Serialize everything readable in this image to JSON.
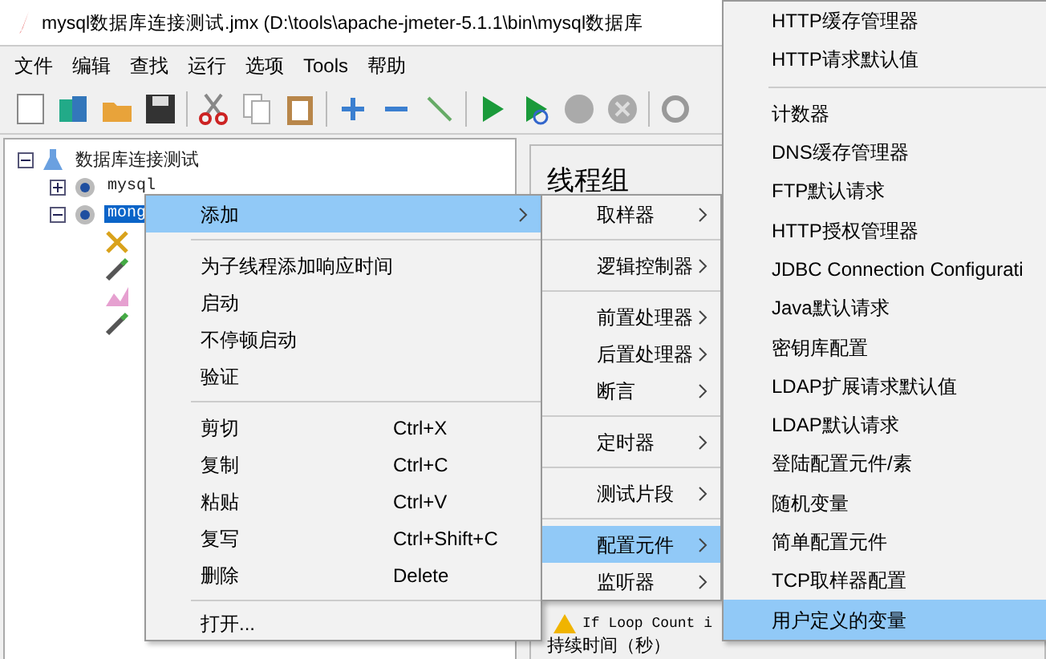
{
  "window": {
    "title": "mysql数据库连接测试.jmx (D:\\tools\\apache-jmeter-5.1.1\\bin\\mysql数据库"
  },
  "menubar": [
    "文件",
    "编辑",
    "查找",
    "运行",
    "选项",
    "Tools",
    "帮助"
  ],
  "toolbar": [
    {
      "kind": "new"
    },
    {
      "kind": "templates"
    },
    {
      "kind": "open"
    },
    {
      "kind": "save"
    },
    {
      "kind": "sep"
    },
    {
      "kind": "cut"
    },
    {
      "kind": "copy"
    },
    {
      "kind": "paste"
    },
    {
      "kind": "sep"
    },
    {
      "kind": "add"
    },
    {
      "kind": "remove"
    },
    {
      "kind": "toggle"
    },
    {
      "kind": "sep"
    },
    {
      "kind": "start"
    },
    {
      "kind": "start-no-pause"
    },
    {
      "kind": "stop"
    },
    {
      "kind": "shutdown"
    },
    {
      "kind": "sep"
    },
    {
      "kind": "gear"
    }
  ],
  "tree": [
    {
      "label": "数据库连接测试",
      "kind": "plan",
      "expanded": true,
      "selected": false,
      "children": [
        {
          "label": "mysql",
          "kind": "group",
          "expanded": false,
          "selected": false
        },
        {
          "label": "mong",
          "kind": "group",
          "expanded": true,
          "selected": true,
          "children": [
            {
              "kind": "tool"
            },
            {
              "kind": "sampler"
            },
            {
              "kind": "listener"
            },
            {
              "kind": "sampler"
            }
          ]
        }
      ]
    }
  ],
  "panel": {
    "title": "线程组",
    "warning": "If Loop Count i",
    "duration_label": "持续时间（秒）"
  },
  "context_menu": [
    {
      "kind": "item",
      "label": "添加",
      "submenu": true,
      "selected": true
    },
    {
      "kind": "separator"
    },
    {
      "kind": "item",
      "label": "为子线程添加响应时间",
      "selected": false
    },
    {
      "kind": "item",
      "label": "启动",
      "selected": false
    },
    {
      "kind": "item",
      "label": "不停顿启动",
      "selected": false
    },
    {
      "kind": "item",
      "label": "验证",
      "selected": false
    },
    {
      "kind": "separator"
    },
    {
      "kind": "item",
      "label": "剪切",
      "shortcut": "Ctrl+X",
      "selected": false
    },
    {
      "kind": "item",
      "label": "复制",
      "shortcut": "Ctrl+C",
      "selected": false
    },
    {
      "kind": "item",
      "label": "粘贴",
      "shortcut": "Ctrl+V",
      "selected": false
    },
    {
      "kind": "item",
      "label": "复写",
      "shortcut": "Ctrl+Shift+C",
      "selected": false
    },
    {
      "kind": "item",
      "label": "删除",
      "shortcut": "Delete",
      "selected": false
    },
    {
      "kind": "separator"
    },
    {
      "kind": "item",
      "label": "打开...",
      "selected": false
    }
  ],
  "add_submenu": [
    {
      "kind": "item",
      "label": "取样器",
      "submenu": true,
      "selected": false
    },
    {
      "kind": "separator"
    },
    {
      "kind": "item",
      "label": "逻辑控制器",
      "submenu": true,
      "selected": false
    },
    {
      "kind": "separator"
    },
    {
      "kind": "item",
      "label": "前置处理器",
      "submenu": true,
      "selected": false
    },
    {
      "kind": "item",
      "label": "后置处理器",
      "submenu": true,
      "selected": false
    },
    {
      "kind": "item",
      "label": "断言",
      "submenu": true,
      "selected": false
    },
    {
      "kind": "separator"
    },
    {
      "kind": "item",
      "label": "定时器",
      "submenu": true,
      "selected": false
    },
    {
      "kind": "separator"
    },
    {
      "kind": "item",
      "label": "测试片段",
      "submenu": true,
      "selected": false
    },
    {
      "kind": "separator"
    },
    {
      "kind": "item",
      "label": "配置元件",
      "submenu": true,
      "selected": true
    },
    {
      "kind": "item",
      "label": "监听器",
      "submenu": true,
      "selected": false
    }
  ],
  "config_submenu": [
    {
      "kind": "item",
      "label": "HTTP缓存管理器",
      "selected": false
    },
    {
      "kind": "item",
      "label": "HTTP请求默认值",
      "selected": false
    },
    {
      "kind": "separator"
    },
    {
      "kind": "item",
      "label": "计数器",
      "selected": false
    },
    {
      "kind": "item",
      "label": "DNS缓存管理器",
      "selected": false
    },
    {
      "kind": "item",
      "label": "FTP默认请求",
      "selected": false
    },
    {
      "kind": "item",
      "label": "HTTP授权管理器",
      "selected": false
    },
    {
      "kind": "item",
      "label": "JDBC Connection Configurati",
      "selected": false
    },
    {
      "kind": "item",
      "label": "Java默认请求",
      "selected": false
    },
    {
      "kind": "item",
      "label": "密钥库配置",
      "selected": false
    },
    {
      "kind": "item",
      "label": "LDAP扩展请求默认值",
      "selected": false
    },
    {
      "kind": "item",
      "label": "LDAP默认请求",
      "selected": false
    },
    {
      "kind": "item",
      "label": "登陆配置元件/素",
      "selected": false
    },
    {
      "kind": "item",
      "label": "随机变量",
      "selected": false
    },
    {
      "kind": "item",
      "label": "简单配置元件",
      "selected": false
    },
    {
      "kind": "item",
      "label": "TCP取样器配置",
      "selected": false
    },
    {
      "kind": "item",
      "label": "用户定义的变量",
      "selected": true
    }
  ]
}
